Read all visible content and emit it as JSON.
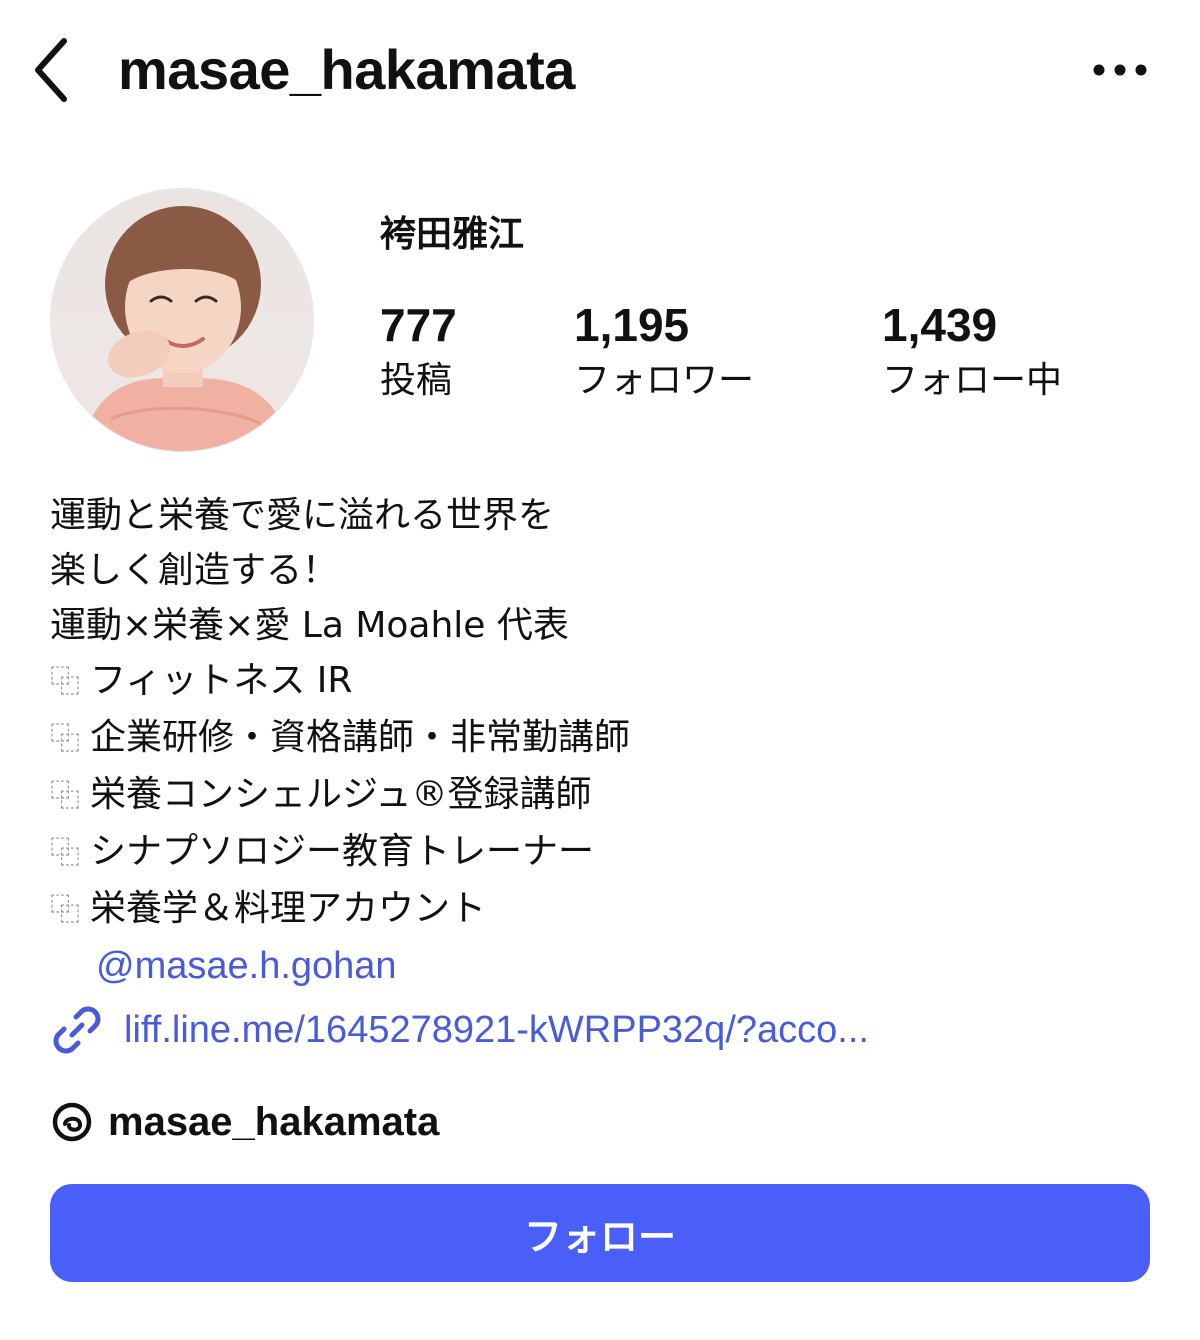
{
  "header": {
    "username": "masae_hakamata",
    "back_icon": "chevron-left-icon",
    "more_icon": "more-horizontal-icon"
  },
  "profile": {
    "display_name": "袴田雅江",
    "avatar_icon": "profile-photo"
  },
  "stats": [
    {
      "count": "777",
      "label": "投稿"
    },
    {
      "count": "1,195",
      "label": "フォロワー"
    },
    {
      "count": "1,439",
      "label": "フォロー中"
    }
  ],
  "bio": {
    "lines": [
      "運動と栄養で愛に溢れる世界を",
      "楽しく創造する！",
      "運動×栄養×愛 La Moahle 代表"
    ],
    "bullet_glyph": "⿻",
    "bullets": [
      "フィットネス IR",
      "企業研修・資格講師・非常勤講師",
      "栄養コンシェルジュ®登録講師",
      "シナプソロジー教育トレーナー",
      "栄養学＆料理アカウント"
    ],
    "mention": "@masae.h.gohan"
  },
  "link": {
    "icon": "link-icon",
    "text": "liff.line.me/1645278921-kWRPP32q/?acco..."
  },
  "threads": {
    "icon": "threads-icon",
    "handle": "masae_hakamata"
  },
  "follow_button": {
    "label": "フォロー"
  },
  "colors": {
    "accent": "#4a5ff7",
    "link": "#4a5bd8",
    "text": "#111111",
    "background": "#ffffff"
  }
}
